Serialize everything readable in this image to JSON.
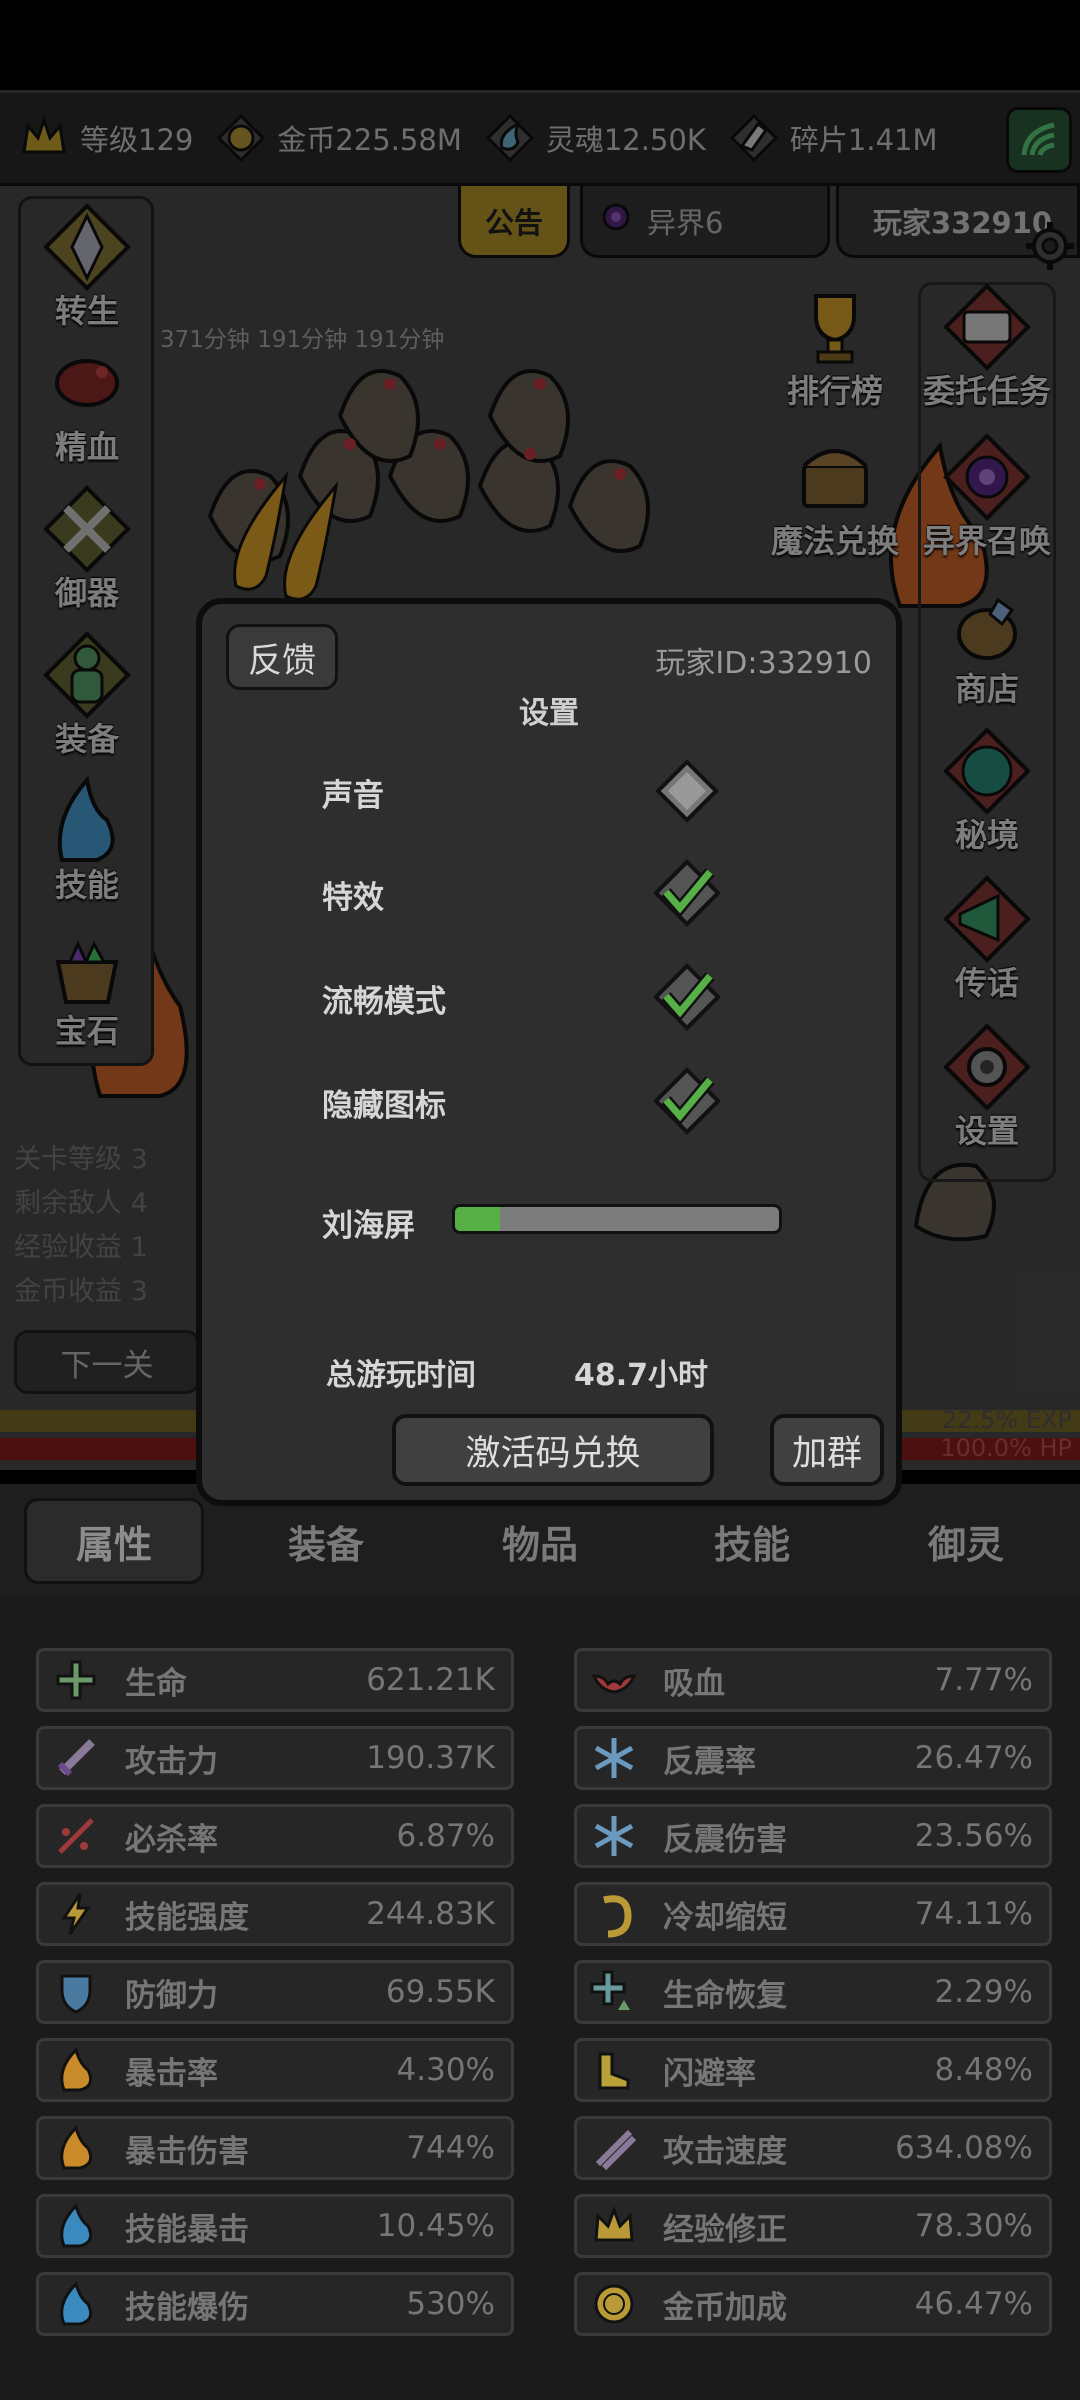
{
  "resources": [
    {
      "icon": "crown-icon",
      "text": "等级129"
    },
    {
      "icon": "gold-coin-icon",
      "text": "金币225.58M"
    },
    {
      "icon": "soul-icon",
      "text": "灵魂12.50K"
    },
    {
      "icon": "fragment-icon",
      "text": "碎片1.41M"
    }
  ],
  "top_tabs": {
    "notice": "公告",
    "world": "异界6",
    "player": "玩家332910"
  },
  "left_menu": [
    "转生",
    "精血",
    "御器",
    "装备",
    "技能",
    "宝石"
  ],
  "right_menu": [
    "排行榜",
    "委托任务",
    "魔法兑换",
    "异界召唤",
    "商店",
    "秘境",
    "传话",
    "设置"
  ],
  "timers": "371分钟  191分钟  191分钟",
  "stage_info": [
    "关卡等级",
    "剩余敌人",
    "经验收益",
    "金币收益"
  ],
  "stage_info_values": [
    "3",
    "4",
    "1",
    "3"
  ],
  "next_button": "下一关",
  "exp_text": "22.5% EXP",
  "hp_text": "100.0% HP",
  "settings": {
    "feedback": "反馈",
    "player_id": "玩家ID:332910",
    "title": "设置",
    "options": [
      {
        "label": "声音",
        "checked": false
      },
      {
        "label": "特效",
        "checked": true
      },
      {
        "label": "流畅模式",
        "checked": true
      },
      {
        "label": "隐藏图标",
        "checked": true
      }
    ],
    "notch_label": "刘海屏",
    "notch_level": 0.14,
    "playtime_label": "总游玩时间",
    "playtime_value": "48.7小时",
    "code_button": "激活码兑换",
    "group_button": "加群"
  },
  "tabs": [
    "属性",
    "装备",
    "物品",
    "技能",
    "御灵"
  ],
  "active_tab": 0,
  "attributes_left": [
    {
      "name": "生命",
      "value": "621.21K",
      "icon": "life-cross-icon"
    },
    {
      "name": "攻击力",
      "value": "190.37K",
      "icon": "sword-icon"
    },
    {
      "name": "必杀率",
      "value": "6.87%",
      "icon": "slash-icon"
    },
    {
      "name": "技能强度",
      "value": "244.83K",
      "icon": "lightning-icon"
    },
    {
      "name": "防御力",
      "value": "69.55K",
      "icon": "shield-icon"
    },
    {
      "name": "暴击率",
      "value": "4.30%",
      "icon": "fire-icon"
    },
    {
      "name": "暴击伤害",
      "value": "744%",
      "icon": "fire-icon"
    },
    {
      "name": "技能暴击",
      "value": "10.45%",
      "icon": "blue-fire-icon"
    },
    {
      "name": "技能爆伤",
      "value": "530%",
      "icon": "blue-fire-icon"
    }
  ],
  "attributes_right": [
    {
      "name": "吸血",
      "value": "7.77%",
      "icon": "bat-icon"
    },
    {
      "name": "反震率",
      "value": "26.47%",
      "icon": "frost-icon"
    },
    {
      "name": "反震伤害",
      "value": "23.56%",
      "icon": "frost-icon"
    },
    {
      "name": "冷却缩短",
      "value": "74.11%",
      "icon": "cooldown-icon"
    },
    {
      "name": "生命恢复",
      "value": "2.29%",
      "icon": "regen-icon"
    },
    {
      "name": "闪避率",
      "value": "8.48%",
      "icon": "boot-icon"
    },
    {
      "name": "攻击速度",
      "value": "634.08%",
      "icon": "twin-swords-icon"
    },
    {
      "name": "经验修正",
      "value": "78.30%",
      "icon": "crown-icon"
    },
    {
      "name": "金币加成",
      "value": "46.47%",
      "icon": "gold-coin-icon"
    }
  ],
  "colors": {
    "accent_gold": "#b8952a",
    "check_green": "#56b046",
    "hp_red": "#8a1e1e"
  }
}
